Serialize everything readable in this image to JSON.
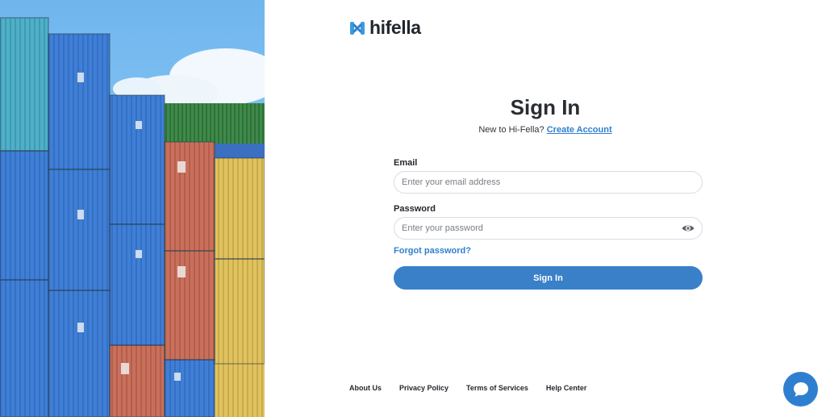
{
  "brand": {
    "name": "hifella",
    "logo_icon": "hifella-logo-icon"
  },
  "signin": {
    "title": "Sign In",
    "new_user_text": "New to Hi-Fella?",
    "create_account_link": "Create Account"
  },
  "form": {
    "email_label": "Email",
    "email_placeholder": "Enter your email address",
    "email_value": "",
    "password_label": "Password",
    "password_placeholder": "Enter your password",
    "password_value": "",
    "forgot_password": "Forgot password?",
    "submit_label": "Sign In"
  },
  "footer": {
    "links": [
      "About Us",
      "Privacy Policy",
      "Terms of Services",
      "Help Center"
    ]
  },
  "icons": {
    "show_password": "eye-icon",
    "chat": "chat-bubble-icon"
  },
  "colors": {
    "accent": "#3a80c9",
    "link": "#2f80cf",
    "text": "#2a2d31"
  }
}
